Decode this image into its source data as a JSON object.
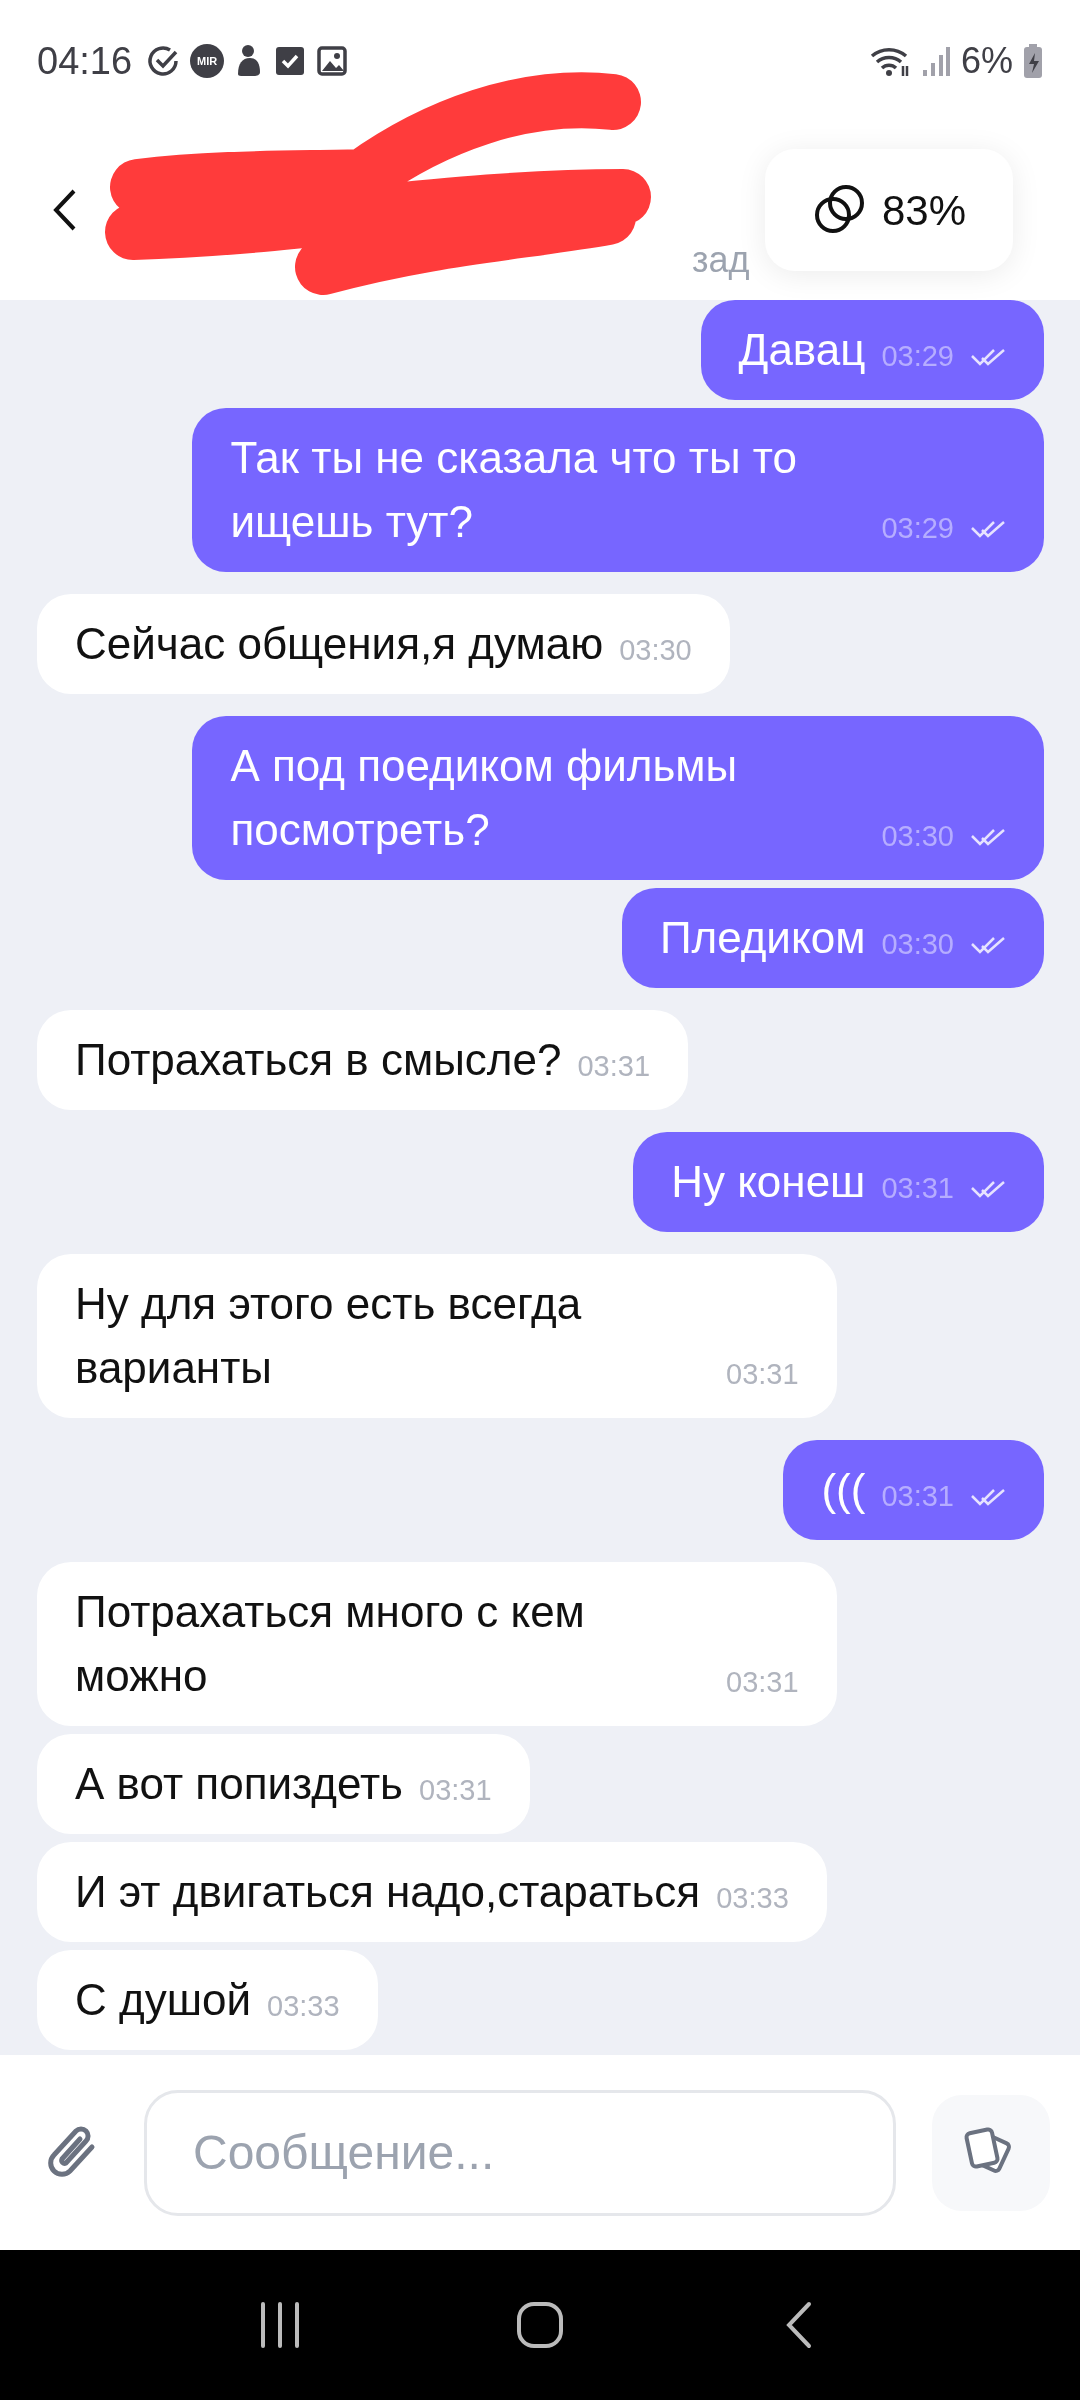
{
  "status_bar": {
    "time": "04:16",
    "badge": "MIR",
    "battery": "6%"
  },
  "header": {
    "subtitle": "зад",
    "match": "83%"
  },
  "messages": [
    {
      "kind": "outgoing",
      "text": "Давац",
      "time": "03:29",
      "read": true
    },
    {
      "kind": "outgoing",
      "text": "Так ты не сказала что ты то ищешь тут?",
      "time": "03:29",
      "read": true
    },
    {
      "kind": "incoming",
      "text": "Сейчас общения,я думаю",
      "time": "03:30"
    },
    {
      "kind": "outgoing",
      "text": "А под поедиком фильмы посмотреть?",
      "time": "03:30",
      "read": true
    },
    {
      "kind": "outgoing",
      "text": "Пледиком",
      "time": "03:30",
      "read": true
    },
    {
      "kind": "incoming",
      "text": "Потрахаться в смысле?",
      "time": "03:31"
    },
    {
      "kind": "outgoing",
      "text": "Ну конеш",
      "time": "03:31",
      "read": true
    },
    {
      "kind": "incoming",
      "text": "Ну для этого есть всегда варианты",
      "time": "03:31"
    },
    {
      "kind": "outgoing",
      "text": "(((",
      "time": "03:31",
      "read": true
    },
    {
      "kind": "incoming",
      "text": "Потрахаться много с кем можно",
      "time": "03:31"
    },
    {
      "kind": "incoming",
      "text": "А вот попиздеть",
      "time": "03:31"
    },
    {
      "kind": "incoming",
      "text": "И эт двигаться надо,стараться",
      "time": "03:33"
    },
    {
      "kind": "incoming",
      "text": "С душой",
      "time": "03:33"
    }
  ],
  "composer": {
    "placeholder": "Сообщение..."
  }
}
